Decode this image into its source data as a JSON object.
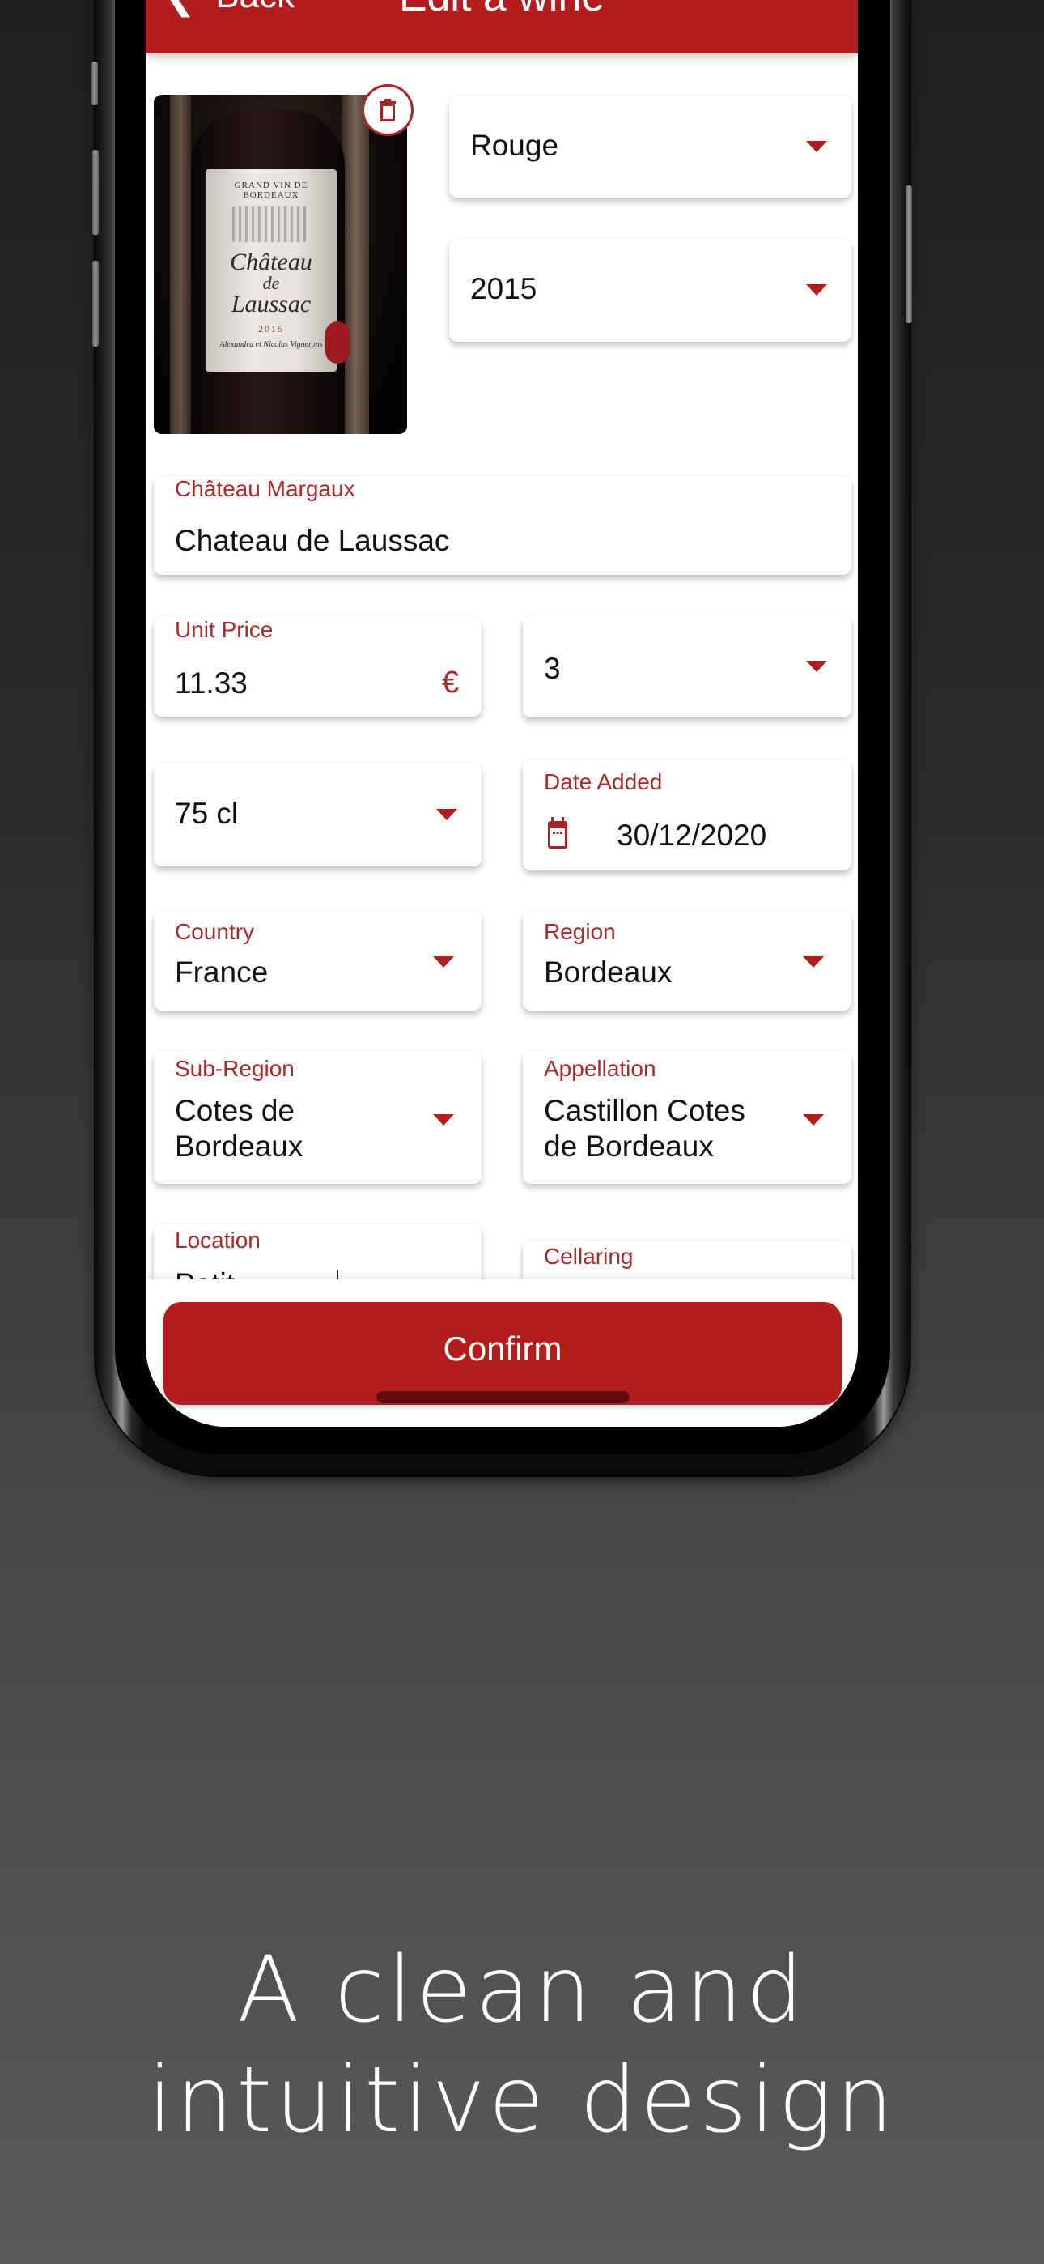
{
  "header": {
    "back_label": "Back",
    "title": "Edit a wine",
    "icons": {
      "back": "chevron-left-icon"
    }
  },
  "photo": {
    "alt": "Wine bottle photo",
    "label_top": "GRAND VIN DE BORDEAUX",
    "label_name_line1": "Château",
    "label_name_line2": "de",
    "label_name_line3": "Laussac",
    "label_year": "2015",
    "label_signature": "Alexandra et Nicolas Vignerons",
    "delete_icon": "trash-icon"
  },
  "form": {
    "color": {
      "value": "Rouge"
    },
    "vintage": {
      "value": "2015"
    },
    "name": {
      "label": "Château Margaux",
      "value": "Chateau de Laussac"
    },
    "unit_price": {
      "label": "Unit Price",
      "value": "11.33",
      "currency": "€"
    },
    "quantity": {
      "value": "3"
    },
    "bottle_size": {
      "value": "75 cl"
    },
    "date_added": {
      "label": "Date Added",
      "value": "30/12/2020",
      "icon": "calendar-icon"
    },
    "country": {
      "label": "Country",
      "value": "France"
    },
    "region": {
      "label": "Region",
      "value": "Bordeaux"
    },
    "sub_region": {
      "label": "Sub-Region",
      "value_line1": "Cotes de",
      "value_line2": "Bordeaux"
    },
    "appellation": {
      "label": "Appellation",
      "value_line1": "Castillon Cotes",
      "value_line2": "de Bordeaux"
    },
    "location": {
      "label": "Location",
      "value": "Petit..."
    },
    "cellaring": {
      "label": "Cellaring"
    }
  },
  "actions": {
    "confirm_label": "Confirm"
  },
  "headline": {
    "line1": "A clean and",
    "line2": "intuitive design"
  },
  "colors": {
    "accent": "#b31d1d",
    "label": "#a92a2a",
    "background_top": "#1f1f1f",
    "background_bottom": "#5a5a5a"
  }
}
